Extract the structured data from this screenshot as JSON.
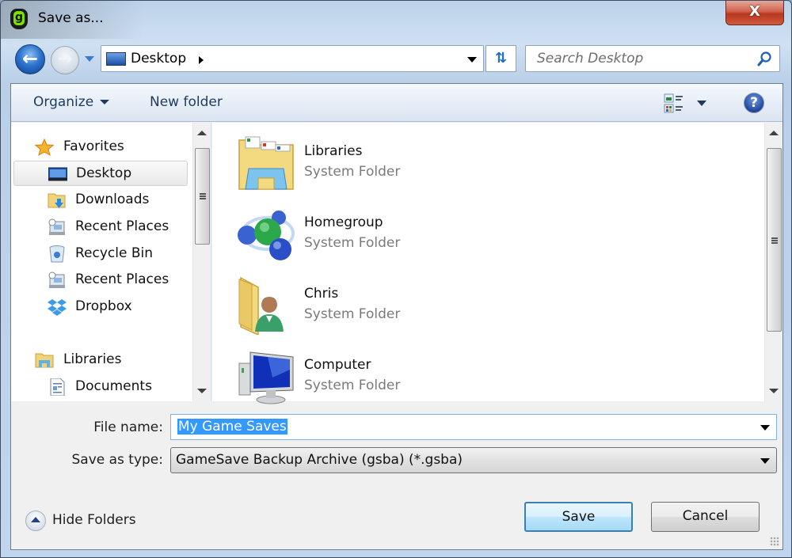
{
  "window": {
    "title": "Save as...",
    "close_label": "X"
  },
  "nav": {
    "back_icon": "back-arrow-icon",
    "forward_icon": "forward-arrow-icon",
    "address": {
      "location": "Desktop",
      "icon": "desktop-icon"
    },
    "refresh_icon": "refresh-icon",
    "search": {
      "placeholder": "Search Desktop",
      "icon": "search-icon"
    }
  },
  "toolbar": {
    "organize_label": "Organize",
    "new_folder_label": "New folder",
    "views_icon": "change-view-icon",
    "help_label": "?"
  },
  "sidebar": {
    "groups": [
      {
        "label": "Favorites",
        "icon": "star-icon",
        "items": [
          {
            "label": "Desktop",
            "icon": "desktop-icon",
            "selected": true
          },
          {
            "label": "Downloads",
            "icon": "downloads-folder-icon"
          },
          {
            "label": "Recent Places",
            "icon": "recent-places-icon"
          },
          {
            "label": "Recycle Bin",
            "icon": "recycle-bin-icon"
          },
          {
            "label": "Recent Places",
            "icon": "recent-places-icon"
          },
          {
            "label": "Dropbox",
            "icon": "dropbox-icon"
          }
        ]
      },
      {
        "label": "Libraries",
        "icon": "libraries-icon",
        "items": [
          {
            "label": "Documents",
            "icon": "documents-icon"
          }
        ]
      }
    ]
  },
  "content": {
    "items": [
      {
        "name": "Libraries",
        "type": "System Folder",
        "icon": "libraries-folder-icon"
      },
      {
        "name": "Homegroup",
        "type": "System Folder",
        "icon": "homegroup-icon"
      },
      {
        "name": "Chris",
        "type": "System Folder",
        "icon": "user-folder-icon"
      },
      {
        "name": "Computer",
        "type": "System Folder",
        "icon": "computer-icon"
      }
    ]
  },
  "form": {
    "file_name_label": "File name:",
    "file_name_value": "My Game Saves",
    "save_type_label": "Save as type:",
    "save_type_value": "GameSave Backup Archive (gsba) (*.gsba)"
  },
  "footer": {
    "hide_folders_label": "Hide Folders",
    "save_label": "Save",
    "cancel_label": "Cancel"
  },
  "colors": {
    "selection": "#3399ff",
    "close_button": "#c9452a",
    "accent": "#3c7fb1"
  }
}
